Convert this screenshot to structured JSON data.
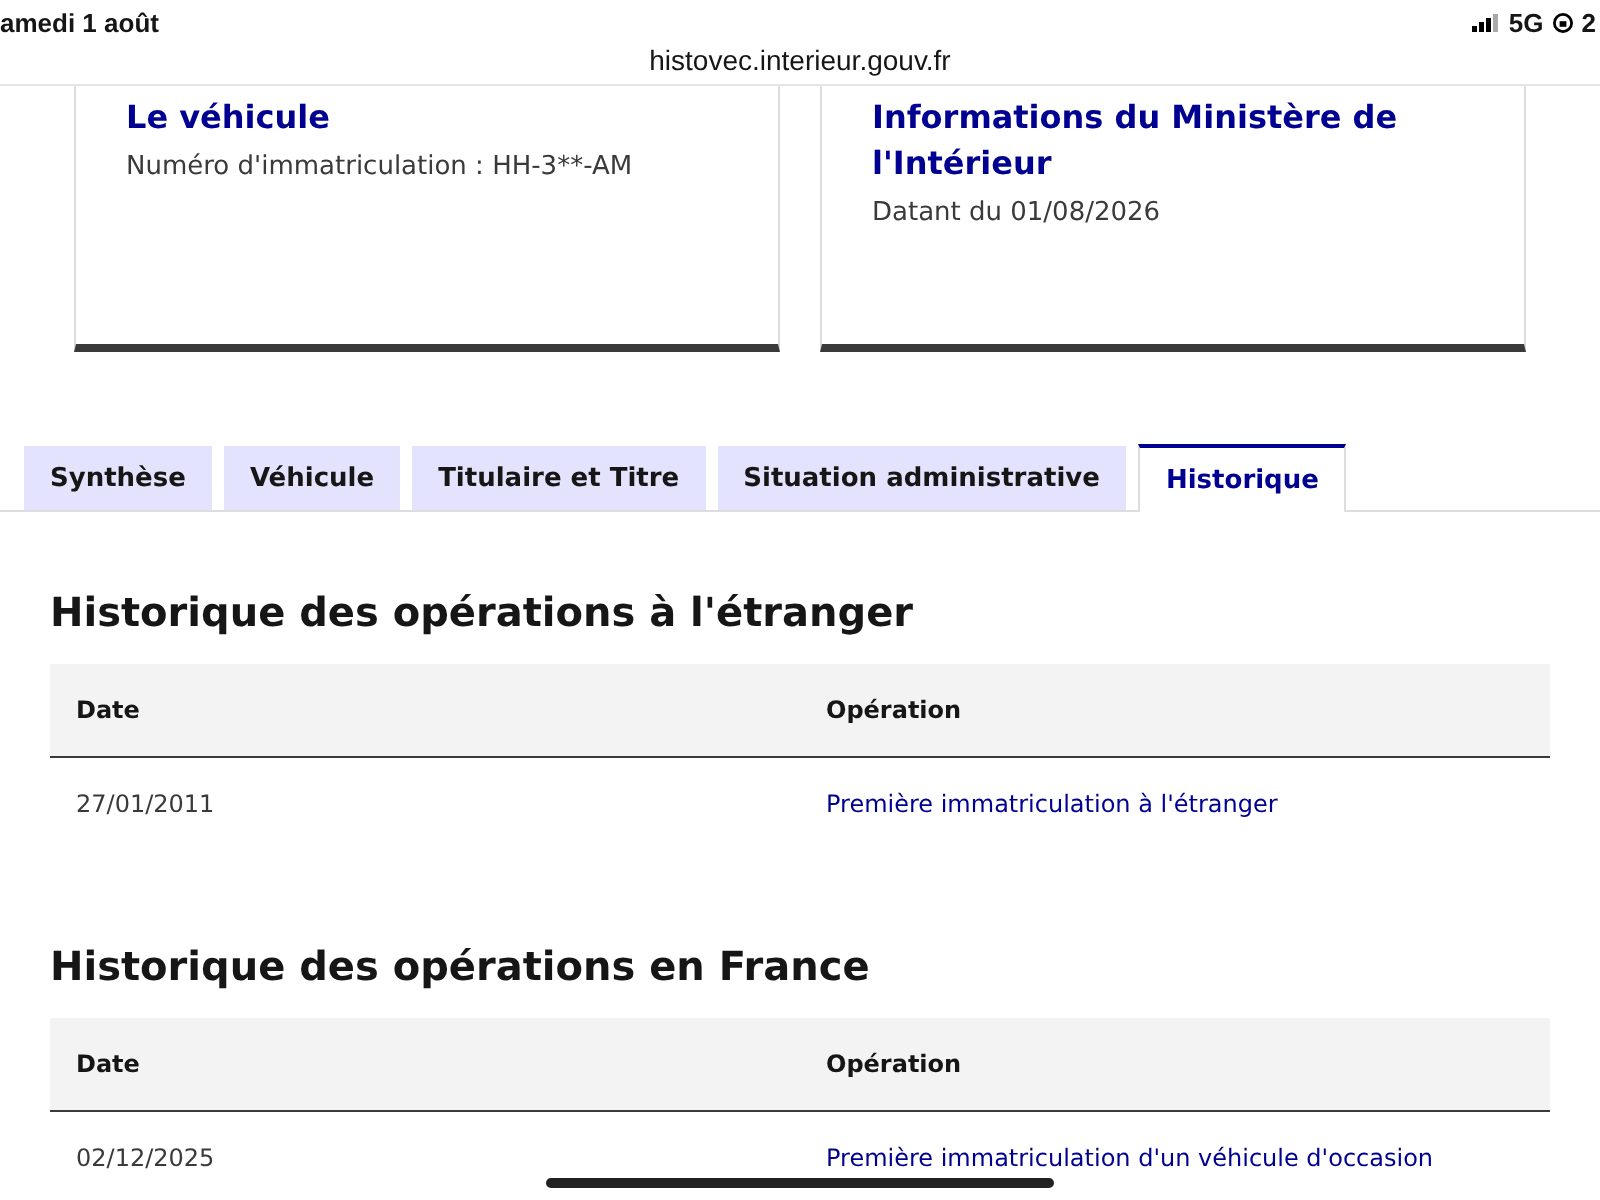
{
  "status_bar": {
    "date": "amedi 1 août",
    "network": "5G",
    "battery": "2"
  },
  "url_bar": {
    "url": "histovec.interieur.gouv.fr"
  },
  "cards": [
    {
      "title": "Le véhicule",
      "text": "Numéro d'immatriculation : HH-3**-AM"
    },
    {
      "title": "Informations du Ministère de l'Intérieur",
      "text": "Datant du 01/08/2026"
    }
  ],
  "tabs": [
    {
      "label": "Synthèse",
      "selected": false
    },
    {
      "label": "Véhicule",
      "selected": false
    },
    {
      "label": "Titulaire et Titre",
      "selected": false
    },
    {
      "label": "Situation administrative",
      "selected": false
    },
    {
      "label": "Historique",
      "selected": true
    }
  ],
  "sections": [
    {
      "title": "Historique des opérations à l'étranger",
      "columns": [
        "Date",
        "Opération"
      ],
      "rows": [
        {
          "date": "27/01/2011",
          "operation": "Première immatriculation à l'étranger"
        }
      ]
    },
    {
      "title": "Historique des opérations en France",
      "columns": [
        "Date",
        "Opération"
      ],
      "rows": [
        {
          "date": "02/12/2025",
          "operation": "Première immatriculation d'un véhicule d'occasion"
        }
      ]
    }
  ]
}
